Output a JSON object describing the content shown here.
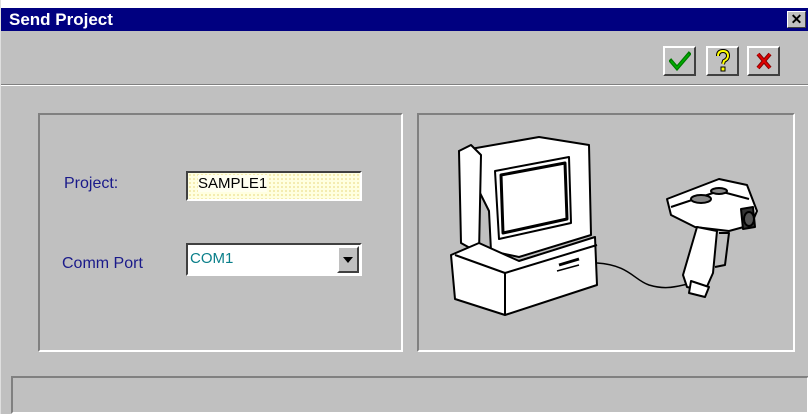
{
  "window": {
    "title": "Send Project",
    "close_symbol": "✕"
  },
  "toolbar": {
    "ok_icon": "check-icon",
    "help_icon": "question-icon",
    "cancel_icon": "x-icon",
    "colors": {
      "check": "#008000",
      "help": "#808000",
      "cancel": "#c00000"
    }
  },
  "form": {
    "project_label": "Project:",
    "project_value": "SAMPLE1",
    "comm_port_label": "Comm Port",
    "comm_port_value": "COM1"
  },
  "illustration": {
    "icon": "computer-and-barcode-scanner-illustration"
  },
  "status_bar": {
    "text": ""
  }
}
